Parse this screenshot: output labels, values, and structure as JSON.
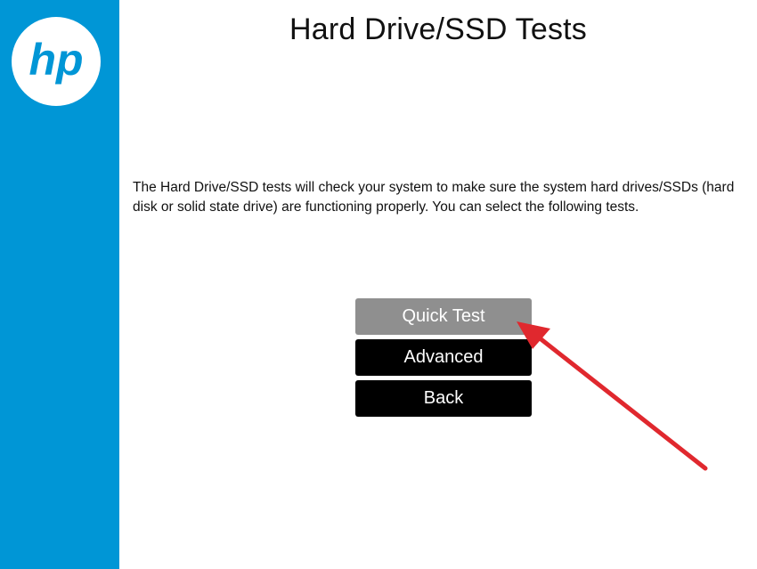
{
  "app": {
    "brand_icon": "hp-logo",
    "brand_color": "#0096d6",
    "logo_text": "hp"
  },
  "header": {
    "title": "Hard Drive/SSD Tests"
  },
  "main": {
    "description": "The Hard Drive/SSD tests will check your system to make sure the system hard drives/SSDs (hard disk or solid state drive) are functioning properly. You can select the following tests.",
    "buttons": [
      {
        "label": "Quick Test",
        "state": "selected"
      },
      {
        "label": "Advanced",
        "state": "normal"
      },
      {
        "label": "Back",
        "state": "normal"
      }
    ]
  },
  "colors": {
    "sidebar": "#0096d6",
    "button_bg": "#000000",
    "button_selected_bg": "#8f8f8f",
    "annotation_arrow": "#e0282e"
  }
}
